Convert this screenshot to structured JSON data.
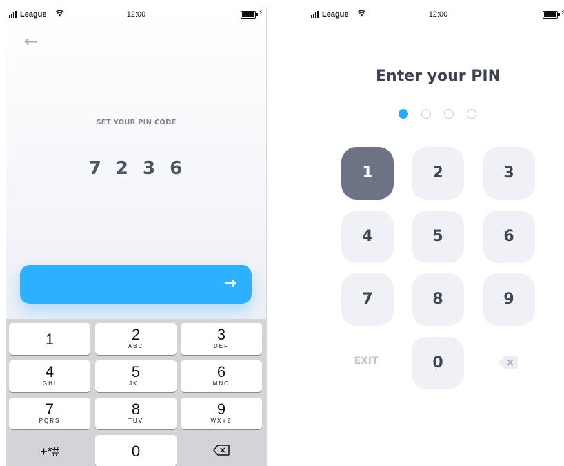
{
  "status_bar": {
    "carrier": "League",
    "time": "12:00"
  },
  "left_screen": {
    "back_icon": "arrow-left-icon",
    "label": "SET YOUR PIN CODE",
    "pin_value": "7 2 3 6",
    "submit_icon": "arrow-right-icon",
    "accent_color": "#2db0ff",
    "keypad": [
      {
        "num": "1",
        "letters": ""
      },
      {
        "num": "2",
        "letters": "ABC"
      },
      {
        "num": "3",
        "letters": "DEF"
      },
      {
        "num": "4",
        "letters": "GHI"
      },
      {
        "num": "5",
        "letters": "JKL"
      },
      {
        "num": "6",
        "letters": "MNO"
      },
      {
        "num": "7",
        "letters": "PQRS"
      },
      {
        "num": "8",
        "letters": "TUV"
      },
      {
        "num": "9",
        "letters": "WXYZ"
      },
      {
        "num": "+*#",
        "letters": ""
      },
      {
        "num": "0",
        "letters": ""
      },
      {
        "num": "",
        "letters": "",
        "icon": "backspace-icon"
      }
    ]
  },
  "right_screen": {
    "title": "Enter your PIN",
    "pin_dots": {
      "total": 4,
      "filled": 1
    },
    "keys": [
      "1",
      "2",
      "3",
      "4",
      "5",
      "6",
      "7",
      "8",
      "9",
      "0"
    ],
    "active_key": "1",
    "exit_label": "EXIT",
    "delete_icon": "backspace-icon"
  }
}
